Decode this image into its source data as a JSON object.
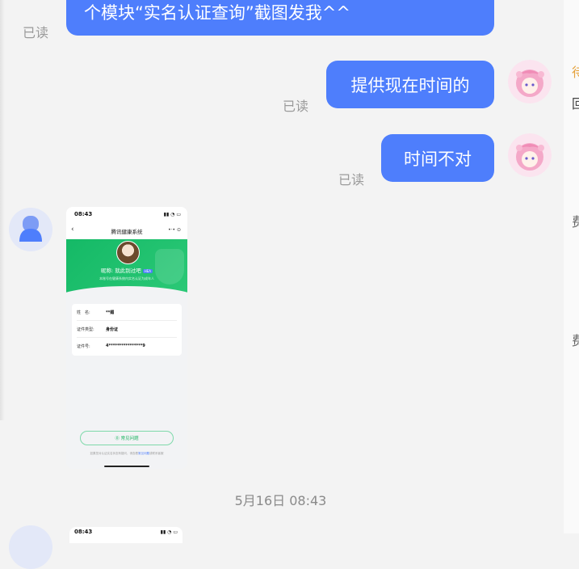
{
  "messages": {
    "m1": {
      "text": "个模块“实名认证查询”截图发我^^",
      "status": "已读"
    },
    "m2": {
      "text": "提供现在时间的",
      "status": "已读"
    },
    "m3": {
      "text": "时间不对",
      "status": "已读"
    }
  },
  "screenshot": {
    "time": "08:43",
    "status_icons": "▮▮ ◔ ▭",
    "back_icon": "‹",
    "title": "腾讯健康系统",
    "menu_icons": "•·• ⊙",
    "nickname": "昵称: 就此别过吧",
    "tag": "HEA",
    "subtitle": "本账号在健康系统内实名认证为成年人",
    "fields": [
      {
        "label": "姓　名:",
        "value": "**媚"
      },
      {
        "label": "证件类型:",
        "value": "身份证"
      },
      {
        "label": "证件号:",
        "value": "4****************9"
      }
    ],
    "faq": "⓪ 常见问题",
    "footer_prefix": "如果您对认证实名状态有疑问，请查看",
    "footer_link": "常见问题",
    "footer_suffix": "或联系客服"
  },
  "timestamp": "5月16日 08:43",
  "screenshot2": {
    "time": "08:43",
    "status_icons": "▮▮ ◔ ▭"
  },
  "right_panel": {
    "a": "待",
    "b": "回",
    "c": "费",
    "d": "费"
  },
  "colors": {
    "bubble": "#4e7efc",
    "green": "#14b966",
    "background": "#f3f3f3"
  }
}
